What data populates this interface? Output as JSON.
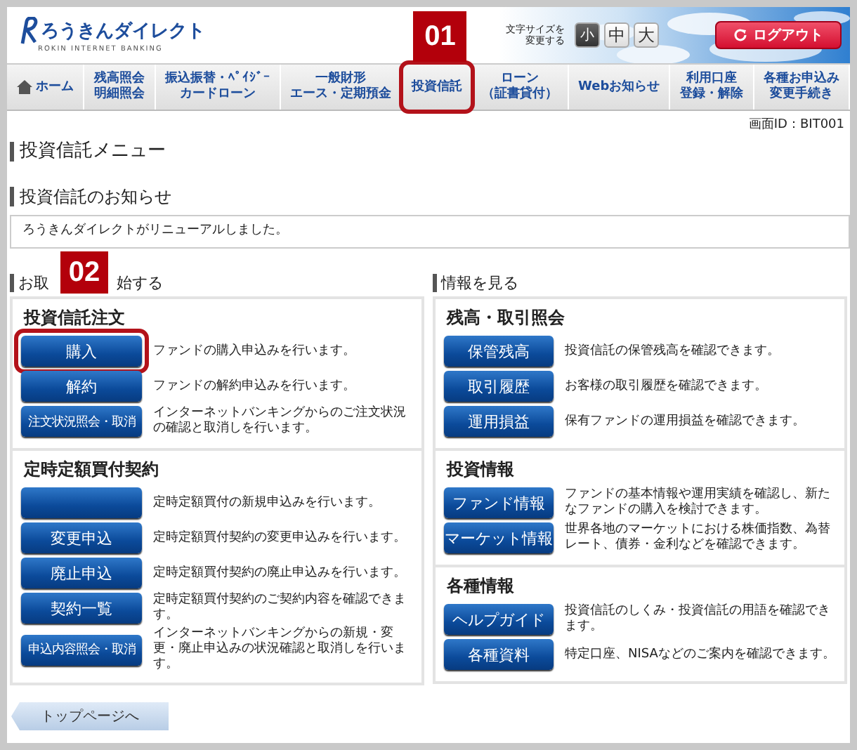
{
  "header": {
    "logo_text": "ろうきんダイレクト",
    "logo_subtext": "ROKIN INTERNET BANKING",
    "font_size_label": [
      "文字サイズを",
      "変更する"
    ],
    "font_sizes": [
      {
        "label": "小",
        "selected": true
      },
      {
        "label": "中",
        "selected": false
      },
      {
        "label": "大",
        "selected": false
      }
    ],
    "logout": "ログアウト"
  },
  "nav": [
    {
      "kind": "home",
      "lines": [
        "ホーム"
      ]
    },
    {
      "kind": "text",
      "lines": [
        "残高照会",
        "明細照会"
      ]
    },
    {
      "kind": "text",
      "lines": [
        "振込振替・ﾍﾟｲｼﾞｰ",
        "カードローン"
      ]
    },
    {
      "kind": "text",
      "lines": [
        "一般財形",
        "エース・定期預金"
      ]
    },
    {
      "kind": "text",
      "lines": [
        "投資信託"
      ],
      "circled": true,
      "callout": "01"
    },
    {
      "kind": "text",
      "lines": [
        "ローン",
        "（証書貸付）"
      ]
    },
    {
      "kind": "text",
      "lines": [
        "Webお知らせ"
      ]
    },
    {
      "kind": "text",
      "lines": [
        "利用口座",
        "登録・解除"
      ]
    },
    {
      "kind": "text",
      "lines": [
        "各種お申込み",
        "変更手続き"
      ]
    }
  ],
  "screen_id": "画面ID：BIT001",
  "title": "投資信託メニュー",
  "notice": {
    "heading": "投資信託のお知らせ",
    "text": "ろうきんダイレクトがリニューアルしました。"
  },
  "order_section": {
    "heading_parts": [
      "お取",
      "始する"
    ],
    "callout": "02",
    "groups": [
      {
        "title": "投資信託注文",
        "items": [
          {
            "button": "購入",
            "kind": "normal",
            "circled": true,
            "desc": "ファンドの購入申込みを行います。"
          },
          {
            "button": "解約",
            "kind": "normal",
            "desc": "ファンドの解約申込みを行います。"
          },
          {
            "button": "注文状況照会・取消",
            "kind": "small",
            "desc": "インターネットバンキングからのご注文状況の確認と取消しを行います。"
          }
        ]
      },
      {
        "title": "定時定額買付契約",
        "items": [
          {
            "kind": "normal",
            "desc": "定時定額買付の新規申込みを行います。"
          },
          {
            "button": "変更申込",
            "kind": "normal",
            "desc": "定時定額買付契約の変更申込みを行います。"
          },
          {
            "button": "廃止申込",
            "kind": "normal",
            "desc": "定時定額買付契約の廃止申込みを行います。"
          },
          {
            "button": "契約一覧",
            "kind": "normal",
            "desc": "定時定額買付契約のご契約内容を確認できます。"
          },
          {
            "button": "申込内容照会・取消",
            "kind": "small",
            "desc": "インターネットバンキングからの新規・変更・廃止申込みの状況確認と取消しを行います。"
          }
        ]
      }
    ]
  },
  "info_section": {
    "heading": "情報を見る",
    "groups": [
      {
        "title": "残高・取引照会",
        "items": [
          {
            "button": "保管残高",
            "desc": "投資信託の保管残高を確認できます。"
          },
          {
            "button": "取引履歴",
            "desc": "お客様の取引履歴を確認できます。"
          },
          {
            "button": "運用損益",
            "desc": "保有ファンドの運用損益を確認できます。"
          }
        ]
      },
      {
        "title": "投資情報",
        "items": [
          {
            "button": "ファンド情報",
            "desc": "ファンドの基本情報や運用実績を確認し、新たなファンドの購入を検討できます。"
          },
          {
            "button": "マーケット情報",
            "desc": "世界各地のマーケットにおける株価指数、為替レート、債券・金利などを確認できます。"
          }
        ]
      },
      {
        "title": "各種情報",
        "items": [
          {
            "button": "ヘルプガイド",
            "desc": "投資信託のしくみ・投資信託の用語を確認できます。"
          },
          {
            "button": "各種資料",
            "desc": "特定口座、NISAなどのご案内を確認できます。"
          }
        ]
      }
    ]
  },
  "back_button": "トップページへ"
}
